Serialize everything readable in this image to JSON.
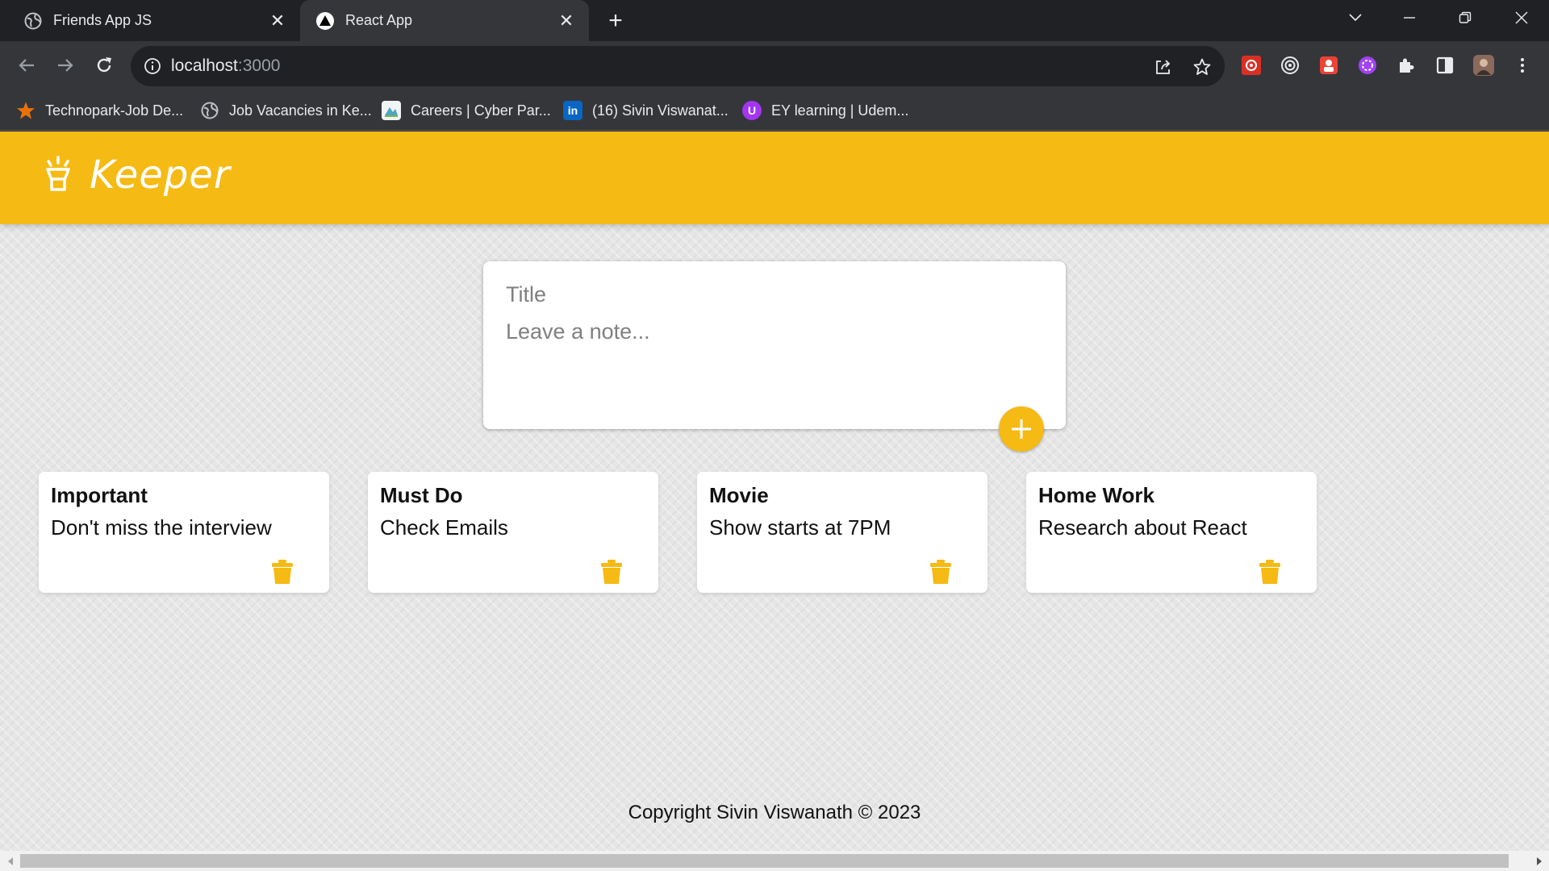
{
  "browser": {
    "tabs": [
      {
        "title": "Friends App JS",
        "active": false,
        "icon": "globe-icon"
      },
      {
        "title": "React App",
        "active": true,
        "icon": "react-app-triangle-icon"
      }
    ],
    "url": {
      "host": "localhost",
      "port": ":3000"
    },
    "bookmarks": [
      {
        "label": "Technopark-Job De...",
        "icon": "star-icon"
      },
      {
        "label": "Job Vacancies in Ke...",
        "icon": "globe-icon"
      },
      {
        "label": "Careers | Cyber Par...",
        "icon": "cyberpark-icon"
      },
      {
        "label": "(16) Sivin Viswanat...",
        "icon": "linkedin-icon"
      },
      {
        "label": "EY learning | Udem...",
        "icon": "udemy-icon"
      }
    ]
  },
  "app": {
    "brand": "Keeper",
    "composer": {
      "title_placeholder": "Title",
      "content_placeholder": "Leave a note..."
    },
    "notes": [
      {
        "title": "Important",
        "content": "Don't miss the interview"
      },
      {
        "title": "Must Do",
        "content": "Check Emails"
      },
      {
        "title": "Movie",
        "content": "Show starts at 7PM"
      },
      {
        "title": "Home Work",
        "content": "Research about React"
      }
    ],
    "footer": "Copyright Sivin Viswanath © 2023"
  },
  "colors": {
    "accent": "#f5ba13",
    "page_bg": "#e6e6e6",
    "chrome_dark": "#202124",
    "chrome_toolbar": "#35363a"
  }
}
